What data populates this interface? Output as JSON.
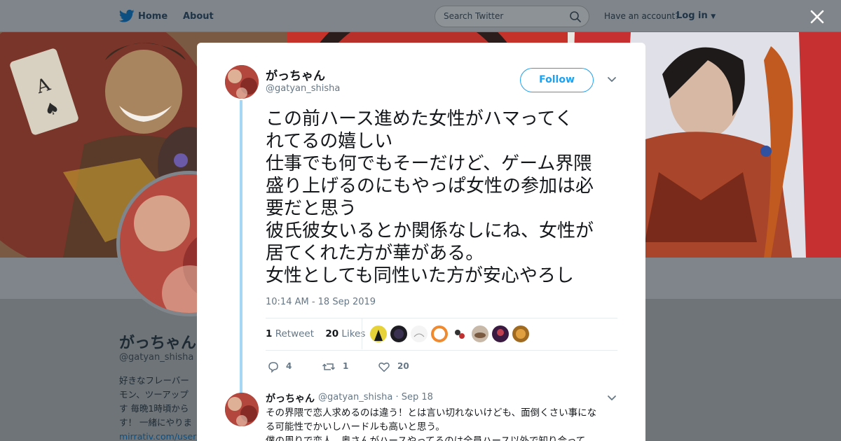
{
  "topbar": {
    "home_label": "Home",
    "about_label": "About",
    "search_placeholder": "Search Twitter",
    "have_account": "Have an account?",
    "login_label": "Log in"
  },
  "profile": {
    "name": "がっちゃん",
    "handle": "@gatyan_shisha",
    "bio_lines": [
      "好きなフレーバー",
      "モン、ツーアップ",
      "す 毎晩1時頃から",
      "す！ 一緒にやりま"
    ],
    "link": "mirrativ.com/user/"
  },
  "tweet": {
    "author_name": "がっちゃん",
    "author_handle": "@gatyan_shisha",
    "follow_label": "Follow",
    "text_lines": [
      "この前ハース進めた女性がハマってく",
      "れてるの嬉しい",
      "仕事でも何でもそーだけど、ゲーム界隈",
      "盛り上げるのにもやっぱ女性の参加は必",
      "要だと思う",
      "彼氏彼女いるとか関係なしにね、女性が",
      "居てくれた方が華がある。",
      "女性としても同性いた方が安心やろし"
    ],
    "timestamp": "10:14 AM - 18 Sep 2019",
    "retweets": "1",
    "retweet_label": "Retweet",
    "likes": "20",
    "likes_label": "Likes",
    "replies_count": "4",
    "retweet_count": "1",
    "like_count": "20"
  },
  "reply": {
    "author_name": "がっちゃん",
    "author_handle": "@gatyan_shisha",
    "date": "· Sep 18",
    "text_lines": [
      "その界隈で恋人求めるのは違う！とは言い切れないけども、面倒くさい事にな",
      "る可能性でかいしハードルも高いと思う。",
      "僕の周りで恋人、奥さんがハースやってるのは全員ハース以外で知り合って"
    ]
  },
  "colors": {
    "accent": "#1da1f2",
    "thread_line": "#a6d7f4",
    "text": "#14171a",
    "muted": "#657786"
  }
}
